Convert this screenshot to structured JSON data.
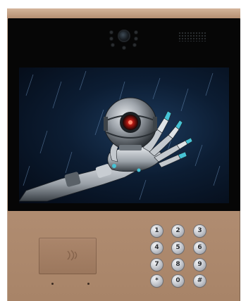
{
  "device": {
    "panel_color": "#b89479",
    "glass_color": "#060606",
    "screen_scene": "robot hand holding spherical camera droid with red lens",
    "camera_icon": "camera-lens-icon",
    "card_reader_icon": "nfc-card-icon"
  },
  "keypad": {
    "keys": [
      "1",
      "2",
      "3",
      "4",
      "5",
      "6",
      "7",
      "8",
      "9",
      "*",
      "0",
      "#"
    ]
  }
}
